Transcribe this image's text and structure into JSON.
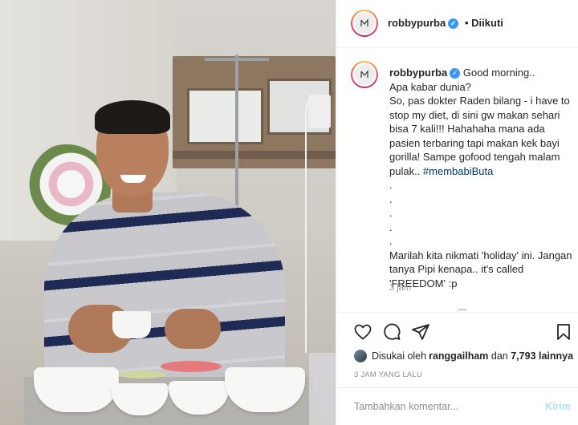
{
  "post_header": {
    "username": "robbypurba",
    "verified_mark": "✓",
    "follow_status": "• Diikuti"
  },
  "caption": {
    "username": "robbypurba",
    "text_before_tag": " Good morning..\nApa kabar dunia?\nSo, pas dokter Raden bilang - i have to stop my diet, di sini gw makan sehari bisa 7 kali!!! Hahahaha mana ada pasien terbaring tapi makan kek bayi gorilla! Sampe gofood tengah malam pulak.. ",
    "hashtag": "#membabiButa",
    "text_after_tag": "\n.\n.\n.\n.\n.\nMarilah kita nikmati 'holiday' ini. Jangan tanya Pipi kenapa.. it's called 'FREEDOM' :p",
    "time": "3 jam"
  },
  "likes": {
    "prefix": "Disukai oleh ",
    "liker": "ranggailham",
    "mid": " dan ",
    "count": "7,793 lainnya"
  },
  "time_ago": "3 JAM YANG LALU",
  "comment": {
    "placeholder": "Tambahkan komentar...",
    "post_label": "Kirim"
  },
  "icons": {
    "like": "heart-icon",
    "comment": "comment-icon",
    "share": "share-icon",
    "save": "bookmark-icon"
  },
  "colors": {
    "verified": "#3897f0",
    "hashtag": "#00376b",
    "muted": "#8e8e8e",
    "post_button_disabled": "#b2dffc"
  }
}
